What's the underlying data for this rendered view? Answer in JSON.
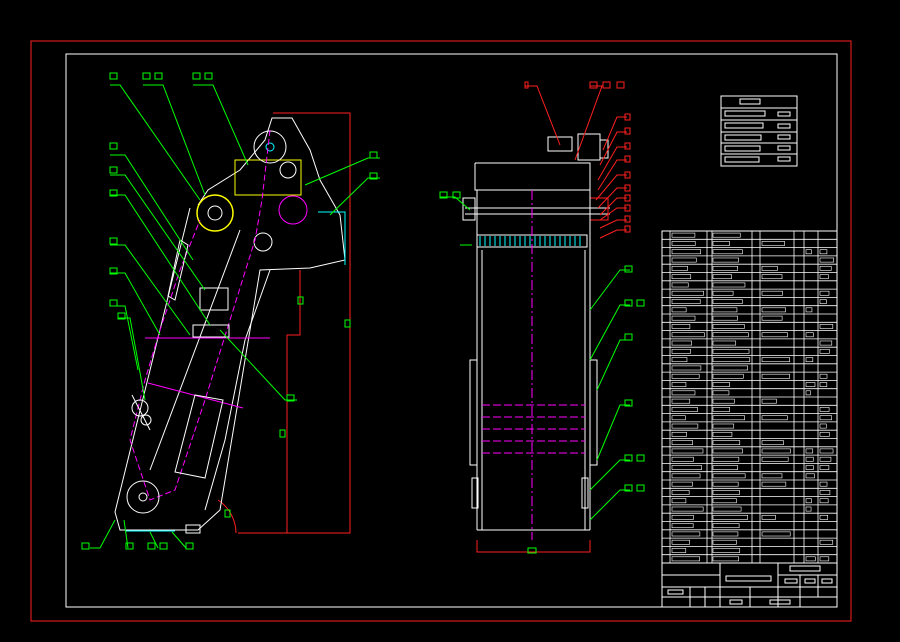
{
  "drawing": {
    "type": "CAD mechanical assembly drawing",
    "views": [
      "side-elevation",
      "front-elevation"
    ],
    "colors": {
      "background": "#000000",
      "sheet_border": "#ff2020",
      "frame": "#ffffff",
      "leader_green": "#00ff00",
      "leader_red": "#ff2020",
      "centerline_magenta": "#ff00ff",
      "outline_white": "#ffffff",
      "hatch_yellow": "#ffff00",
      "part_cyan": "#00ffff"
    },
    "callout_count_side_view": 20,
    "callout_count_front_view": 18,
    "parts_list_rows": 40,
    "text_note": "Text in drawing is rendered as unreadable placeholder glyph blocks"
  }
}
